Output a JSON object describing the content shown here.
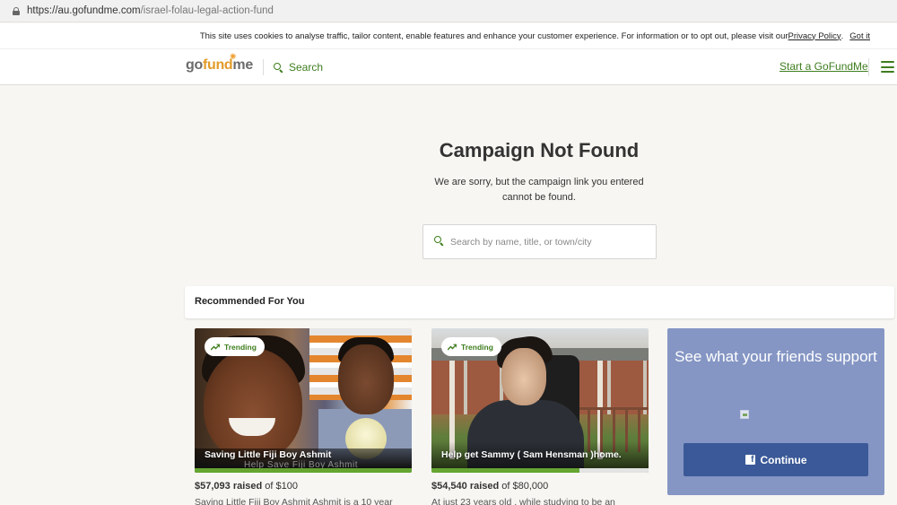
{
  "browser": {
    "url_host": "https://au.gofundme.com",
    "url_path": "/israel-folau-legal-action-fund"
  },
  "cookie_banner": {
    "text": "This site uses cookies to analyse traffic, tailor content, enable features and enhance your customer experience. For information or to opt out, please visit our ",
    "privacy_link": "Privacy Policy",
    "after_link": ".",
    "got_it": "Got it"
  },
  "header": {
    "logo": {
      "go": "go",
      "fund": "fund",
      "me": "me"
    },
    "search_label": "Search",
    "start_label": "Start a GoFundMe",
    "menu_icon": "hamburger-menu-icon"
  },
  "not_found": {
    "title": "Campaign Not Found",
    "message": "We are sorry, but the campaign link you entered cannot be found.",
    "search_placeholder": "Search by name, title, or town/city"
  },
  "recommended": {
    "heading": "Recommended For You",
    "cards": [
      {
        "badge": "Trending",
        "title": "Saving Little Fiji Boy Ashmit",
        "overlay": "Help Save Fiji Boy Ashmit",
        "raised_amount": "$57,093 raised",
        "goal_text": " of $100",
        "progress_pct": 100,
        "description": "Saving Little Fiji Boy Ashmit Ashmit is a 10 year"
      },
      {
        "badge": "Trending",
        "title": "Help get Sammy ( Sam Hensman )home.",
        "raised_amount": "$54,540 raised",
        "goal_text": " of $80,000",
        "progress_pct": 68,
        "description": "At just 23 years old , while studying to be an"
      }
    ]
  },
  "friends": {
    "title": "See what your friends support",
    "button": "Continue",
    "button_color": "#3b5998"
  },
  "colors": {
    "brand_green": "#3e7d1e",
    "progress_green": "#66a532",
    "friends_bg": "#8596c4",
    "logo_orange": "#e39b2a"
  }
}
